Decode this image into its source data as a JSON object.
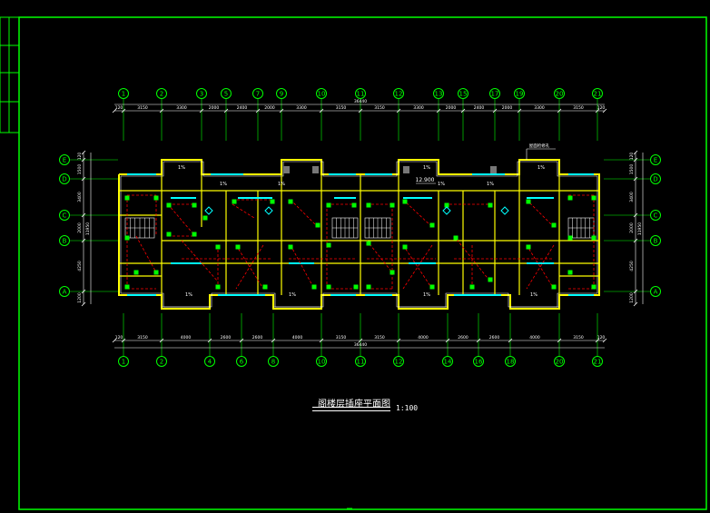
{
  "drawing": {
    "title": "阁楼层插座平面图",
    "scale": "1:100",
    "floor_mark": "12.900",
    "room_label": "1%",
    "note": "屋面检修孔"
  },
  "axes_top": [
    "1",
    "2",
    "3",
    "5",
    "7",
    "9",
    "10",
    "11",
    "12",
    "13",
    "15",
    "17",
    "19",
    "20",
    "21"
  ],
  "axes_bottom": [
    "1",
    "2",
    "4",
    "6",
    "8",
    "10",
    "11",
    "12",
    "14",
    "16",
    "18",
    "20",
    "21"
  ],
  "axes_left": [
    "E",
    "D",
    "C",
    "B",
    "A"
  ],
  "axes_right": [
    "E",
    "D",
    "C",
    "B",
    "A"
  ],
  "dims_top_total": "36440",
  "dims_top": [
    "120",
    "3150",
    "3300",
    "2000",
    "2400",
    "2000",
    "3300",
    "3150",
    "3150",
    "3300",
    "2000",
    "2400",
    "2000",
    "3300",
    "3150",
    "120"
  ],
  "dims_bottom_total": "36440",
  "dims_bottom": [
    "120",
    "3150",
    "4000",
    "2600",
    "2600",
    "4000",
    "3150",
    "3150",
    "4000",
    "2600",
    "2600",
    "4000",
    "3150",
    "120"
  ],
  "dims_left": [
    "120",
    "1500",
    "3400",
    "2000",
    "4250",
    "1200"
  ],
  "dims_left_total": "11950",
  "dims_right": [
    "120",
    "1500",
    "3400",
    "2000",
    "4250",
    "1200"
  ],
  "dims_right_total": "11950",
  "colors": {
    "background": "#000000",
    "frame": "#00ff00",
    "walls": "#ffff00",
    "wiring": "#ff0000",
    "devices": "#00ff00",
    "windows": "#00ffff",
    "axes": "#00ff00",
    "text": "#ffffff"
  }
}
